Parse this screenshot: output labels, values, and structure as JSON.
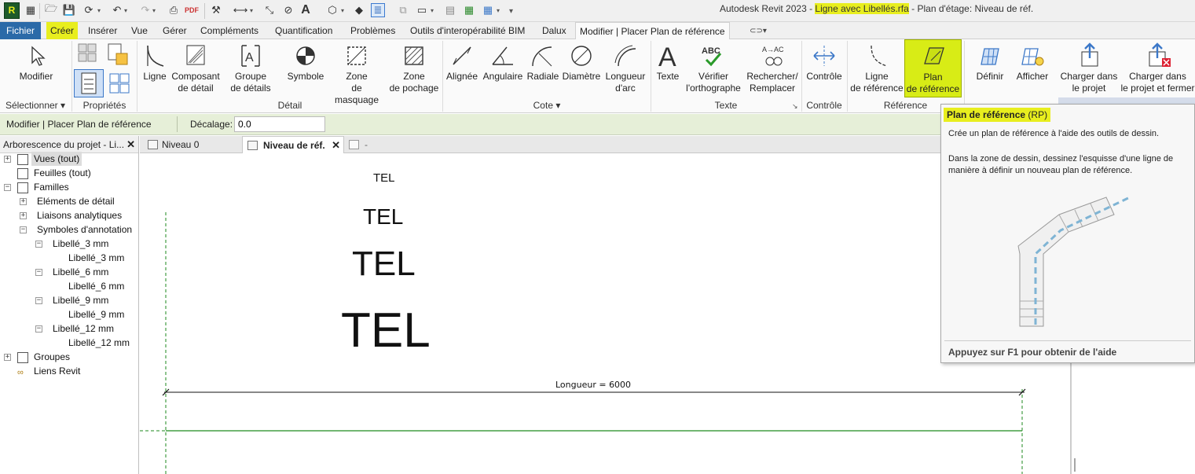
{
  "title": {
    "app": "Autodesk Revit 2023 - ",
    "file": "Ligne avec Libellés.rfa",
    "rest": " - Plan d'étage: Niveau de réf."
  },
  "menu": {
    "file": "Fichier",
    "tabs": [
      "Créer",
      "Insérer",
      "Vue",
      "Gérer",
      "Compléments",
      "Quantification",
      "Problèmes",
      "Outils d'interopérabilité BIM",
      "Dalux",
      "Modifier | Placer Plan de référence"
    ]
  },
  "ribbon": {
    "buttons": [
      {
        "label": "Modifier",
        "icon": "pointer-icon"
      },
      {
        "label": "Ligne",
        "icon": "line-icon"
      },
      {
        "label": "Composant\nde détail",
        "icon": "detail-component-icon"
      },
      {
        "label": "Groupe\nde détails",
        "icon": "detail-group-icon"
      },
      {
        "label": "Symbole",
        "icon": "symbol-icon"
      },
      {
        "label": "Zone\nde masquage",
        "icon": "masking-region-icon"
      },
      {
        "label": "Zone\nde pochage",
        "icon": "filled-region-icon"
      },
      {
        "label": "Alignée",
        "icon": "aligned-dimension-icon"
      },
      {
        "label": "Angulaire",
        "icon": "angular-dimension-icon"
      },
      {
        "label": "Radiale",
        "icon": "radial-dimension-icon"
      },
      {
        "label": "Diamètre",
        "icon": "diameter-dimension-icon"
      },
      {
        "label": "Longueur\nd'arc",
        "icon": "arc-length-icon"
      },
      {
        "label": "Texte",
        "icon": "text-icon"
      },
      {
        "label": "Vérifier\nl'orthographe",
        "icon": "spellcheck-icon"
      },
      {
        "label": "Rechercher/\nRemplacer",
        "icon": "find-replace-icon"
      },
      {
        "label": "Contrôle",
        "icon": "control-icon"
      },
      {
        "label": "Ligne\nde référence",
        "icon": "reference-line-icon"
      },
      {
        "label": "Plan\nde référence",
        "icon": "reference-plane-icon"
      },
      {
        "label": "Définir",
        "icon": "set-workplane-icon"
      },
      {
        "label": "Afficher",
        "icon": "show-workplane-icon"
      },
      {
        "label": "Charger dans\nle projet",
        "icon": "load-into-project-icon"
      },
      {
        "label": "Charger dans\nle projet et fermer",
        "icon": "load-and-close-icon"
      }
    ],
    "groups": [
      "Sélectionner ▾",
      "Propriétés",
      "Détail",
      "Cote ▾",
      "Texte",
      "Contrôle",
      "Référence"
    ]
  },
  "options": {
    "context": "Modifier | Placer Plan de référence",
    "offset_label": "Décalage:",
    "offset_value": "0.0"
  },
  "browser": {
    "header": "Arborescence du projet - Li...",
    "close": "✕",
    "items": [
      "Vues (tout)",
      "Feuilles (tout)",
      "Familles",
      "Eléments de détail",
      "Liaisons analytiques",
      "Symboles d'annotation",
      "Libellé_3 mm",
      "Libellé_3 mm",
      "Libellé_6 mm",
      "Libellé_6 mm",
      "Libellé_9 mm",
      "Libellé_9 mm",
      "Libellé_12 mm",
      "Libellé_12 mm",
      "Groupes",
      "Liens Revit"
    ]
  },
  "view_tabs": [
    {
      "label": "Niveau 0"
    },
    {
      "label": "Niveau de réf.",
      "close": "✕"
    },
    {
      "label": "-"
    }
  ],
  "canvas": {
    "labels": [
      "TEL",
      "TEL",
      "TEL",
      "TEL"
    ],
    "dimension": "Longueur = 6000"
  },
  "tooltip": {
    "title": "Plan de référence",
    "shortcut": "(RP)",
    "line1": "Crée un plan de référence à l'aide des outils de dessin.",
    "line2": "Dans la zone de dessin, dessinez l'esquisse d'une ligne de manière à définir un nouveau plan de référence.",
    "footer": "Appuyez sur F1 pour obtenir de l'aide"
  },
  "colors": {
    "file_tab": "#2b6aa8",
    "highlight": "#e8ee1e",
    "options_bar": "#e6efd8",
    "ref_plane": "#1e8a1e"
  }
}
